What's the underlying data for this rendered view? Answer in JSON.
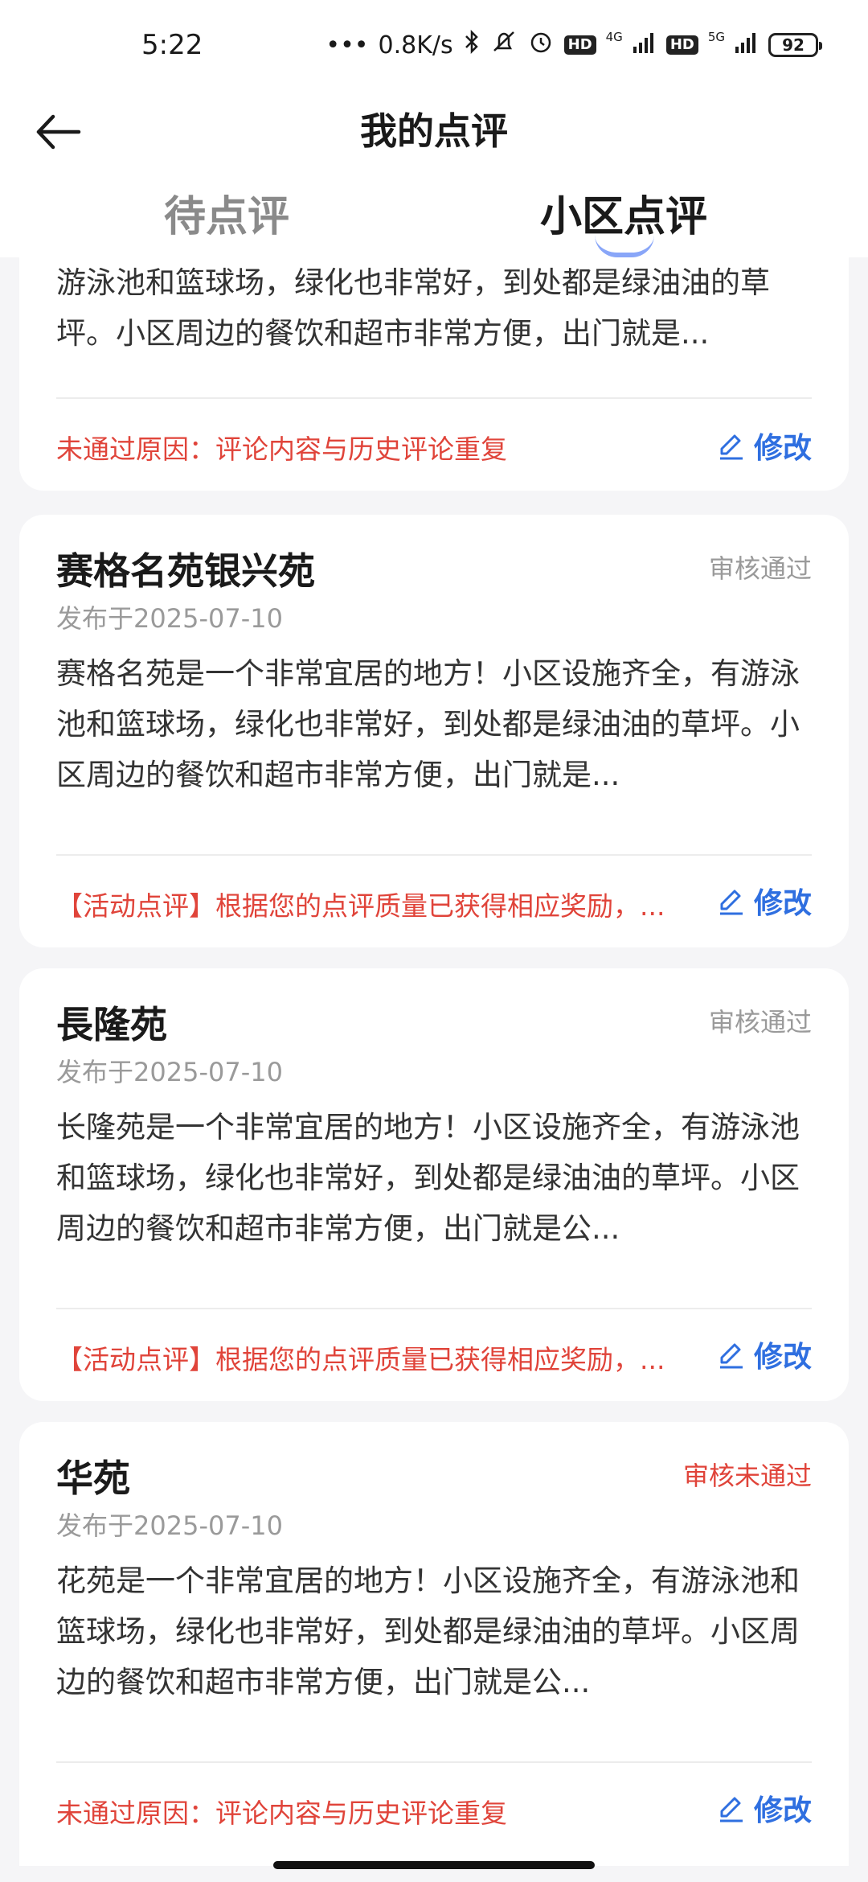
{
  "status_bar": {
    "time": "5:22",
    "speed": "0.8K/s",
    "hd1": "HD",
    "net1": "4G",
    "hd2": "HD",
    "net2": "5G",
    "battery": "92"
  },
  "header": {
    "title": "我的点评",
    "tabs": [
      {
        "label": "待点评"
      },
      {
        "label": "小区点评"
      }
    ]
  },
  "reviews": [
    {
      "body": "游泳池和篮球场，绿化也非常好，到处都是绿油油的草坪。小区周边的餐饮和超市非常方便，出门就是...",
      "note": "未通过原因：评论内容与历史评论重复",
      "edit_label": "修改"
    },
    {
      "title": "赛格名苑银兴苑",
      "status": "审核通过",
      "date": "发布于2025-07-10",
      "body": "赛格名苑是一个非常宜居的地方！小区设施齐全，有游泳池和篮球场，绿化也非常好，到处都是绿油油的草坪。小区周边的餐饮和超市非常方便，出门就是...",
      "note": "【活动点评】根据您的点评质量已获得相应奖励，...",
      "edit_label": "修改"
    },
    {
      "title": "長隆苑",
      "status": "审核通过",
      "date": "发布于2025-07-10",
      "body": "长隆苑是一个非常宜居的地方！小区设施齐全，有游泳池和篮球场，绿化也非常好，到处都是绿油油的草坪。小区周边的餐饮和超市非常方便，出门就是公...",
      "note": "【活动点评】根据您的点评质量已获得相应奖励，...",
      "edit_label": "修改"
    },
    {
      "title": "华苑",
      "status": "审核未通过",
      "date": "发布于2025-07-10",
      "body": "花苑是一个非常宜居的地方！小区设施齐全，有游泳池和篮球场，绿化也非常好，到处都是绿油油的草坪。小区周边的餐饮和超市非常方便，出门就是公...",
      "note": "未通过原因：评论内容与历史评论重复",
      "edit_label": "修改"
    }
  ],
  "colors": {
    "accent_blue": "#2f6fe0",
    "error_red": "#e0443a",
    "muted_gray": "#9a9a9a"
  }
}
